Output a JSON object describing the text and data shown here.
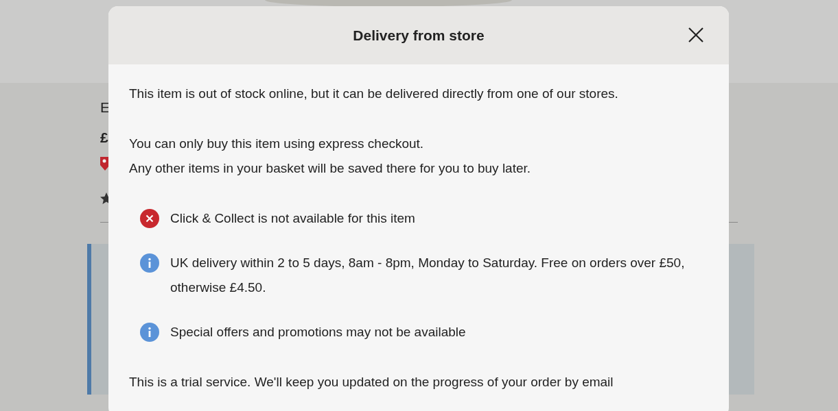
{
  "page": {
    "heading_fragment": "E",
    "price_fragment": "£"
  },
  "modal": {
    "title": "Delivery from store",
    "paragraphs": [
      [
        "This item is out of stock online, but it can be delivered directly from one of our stores."
      ],
      [
        "You can only buy this item using express checkout.",
        "Any other items in your basket will be saved there for you to buy later."
      ]
    ],
    "notices": [
      {
        "kind": "error",
        "text": "Click & Collect is not available for this item"
      },
      {
        "kind": "info",
        "text": "UK delivery within 2 to 5 days, 8am - 8pm, Monday to Saturday. Free on orders over £50, otherwise £4.50."
      },
      {
        "kind": "info",
        "text": "Special offers and promotions may not be available"
      }
    ],
    "footer": "This is a trial service. We'll keep you updated on the progress of your order by email"
  }
}
